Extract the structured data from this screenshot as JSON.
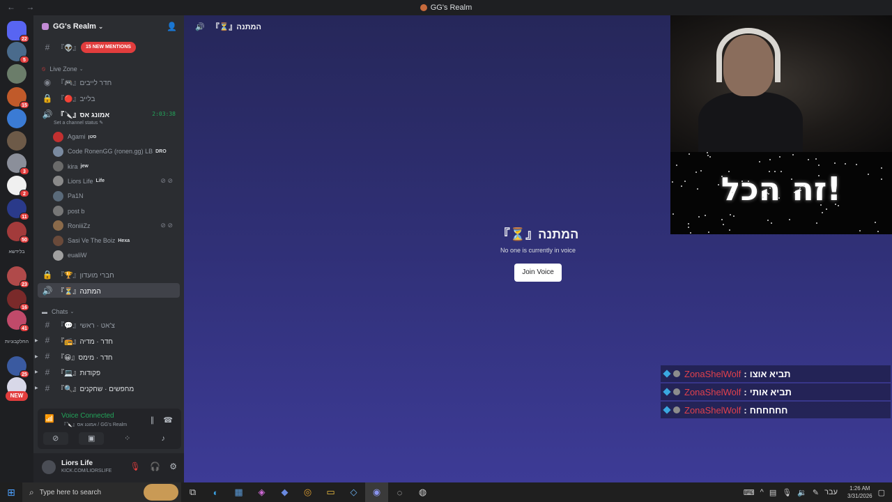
{
  "window": {
    "title": "GG's Realm",
    "back": "←",
    "forward": "→"
  },
  "rail": {
    "servers": [
      {
        "color": "#5865f2",
        "badge": "22"
      },
      {
        "color": "#4a6b8c",
        "badge": "5"
      },
      {
        "color": "#6b7d6a",
        "badge": ""
      },
      {
        "color": "#c05a2a",
        "badge": "15"
      },
      {
        "color": "#3b7bd4",
        "badge": ""
      },
      {
        "color": "#6d5a48",
        "badge": ""
      },
      {
        "color": "#8b8f9a",
        "badge": "3"
      },
      {
        "color": "#f0f0f0",
        "badge": "2"
      },
      {
        "color": "#2a3a8a",
        "badge": "11"
      },
      {
        "color": "#a33b3b",
        "badge": "50"
      },
      {
        "color": "#b04a4a",
        "badge": "23"
      },
      {
        "color": "#7a2a2a",
        "badge": "16"
      },
      {
        "color": "#c04a6a",
        "badge": "41"
      },
      {
        "color": "#3a5aa0",
        "badge": "25"
      },
      {
        "color": "#d8d8e8",
        "badge": ""
      }
    ],
    "label1": "בלידשא",
    "label2": "החלקבוניות",
    "new_badge": "NEW"
  },
  "guild": {
    "name": "GG's Realm",
    "chevron": "⌄"
  },
  "sidebar": {
    "mentions_badge": "15 NEW MENTIONS",
    "top_channel": "『👽』",
    "live_zone": "Live Zone",
    "channels_live": [
      {
        "name": "『🎮』חדר לייבים",
        "icon": "📡"
      },
      {
        "name": "『🔴』בלייב",
        "icon": "🔒"
      }
    ],
    "voice_channel": {
      "name": "『🔪』אמונג אס",
      "timer": "2:03:38",
      "status": "Set a channel status ✎"
    },
    "users": [
      {
        "name": "Agami",
        "tag": "סטן",
        "color": "#c23030"
      },
      {
        "name": "Code RonenGG (ronen.gg) LB",
        "tag": "DRO",
        "color": "#7a8aa0"
      },
      {
        "name": "kira",
        "tag": "jew",
        "color": "#6a6a6a"
      },
      {
        "name": "Liors Life",
        "tag": "Life",
        "color": "#8a8a8a"
      },
      {
        "name": "Pa1N",
        "tag": "",
        "color": "#5a6a7a"
      },
      {
        "name": "post b",
        "tag": "",
        "color": "#777777"
      },
      {
        "name": "RoniiiZz",
        "tag": "",
        "color": "#8a6a4a"
      },
      {
        "name": "Sasi Ve The Boiz",
        "tag": "Hexa",
        "color": "#6a4a3a"
      },
      {
        "name": "eualiW",
        "tag": "",
        "color": "#a0a0a0"
      }
    ],
    "after_voice": [
      {
        "name": "『🏆』חברי מועדון",
        "icon": "🔒"
      },
      {
        "name": "『⏳』המתנה",
        "icon": "🔊"
      }
    ],
    "chats_cat": "Chats",
    "chat_channels": [
      {
        "name": "『💬』צ'אט · ראשי"
      },
      {
        "name": "『📻』חדר · מדיה"
      },
      {
        "name": "『😀』חדר · מימס"
      },
      {
        "name": "『💻』פקודות"
      },
      {
        "name": "『🔍』מחפשים · שחקנים"
      }
    ]
  },
  "voice_panel": {
    "status": "Voice Connected",
    "location": "『🔪』אמונג אס / GG's Realm"
  },
  "user_panel": {
    "name": "Liors Life",
    "sub": "KICK.COM/LIORSLIFE"
  },
  "main": {
    "header": "『⏳』המתנה",
    "title": "『⏳』המתנה",
    "empty_text": "No one is currently in voice",
    "join_label": "Join Voice"
  },
  "overlay": {
    "big_text": "זה הכל!",
    "chat": [
      {
        "user": "ZonaShelWolf",
        "msg": "תביא אוצו"
      },
      {
        "user": "ZonaShelWolf",
        "msg": "תביא אותי"
      },
      {
        "user": "ZonaShelWolf",
        "msg": "חחחחחח"
      }
    ]
  },
  "taskbar": {
    "search_placeholder": "Type here to search",
    "lang": "עבר",
    "time": "1:26 AM",
    "date": "3/31/2026"
  }
}
